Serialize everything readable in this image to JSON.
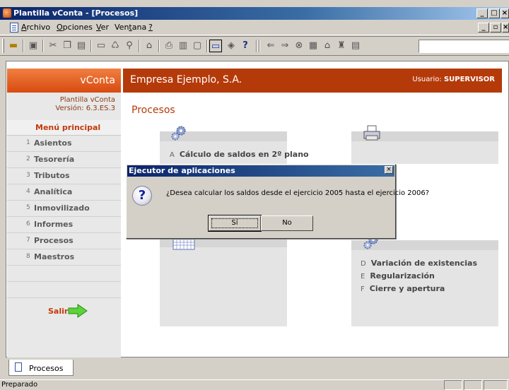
{
  "window": {
    "title": "Plantilla vConta - [Procesos]"
  },
  "menu": {
    "items": [
      {
        "accel": "A",
        "rest": "rchivo"
      },
      {
        "accel": "O",
        "rest": "pciones"
      },
      {
        "accel": "V",
        "rest": "er"
      },
      {
        "pre": "Ven",
        "accel": "t",
        "rest": "ana"
      },
      {
        "accel": "?",
        "rest": ""
      }
    ]
  },
  "sidebar": {
    "brand": "vConta",
    "template_name": "Plantilla vConta",
    "version": "Versión: 6.3.ES.3",
    "section_title": "Menú principal",
    "items": [
      {
        "num": "1",
        "label": "Asientos"
      },
      {
        "num": "2",
        "label": "Tesorería"
      },
      {
        "num": "3",
        "label": "Tributos"
      },
      {
        "num": "4",
        "label": "Analítica"
      },
      {
        "num": "5",
        "label": "Inmovilizado"
      },
      {
        "num": "6",
        "label": "Informes"
      },
      {
        "num": "7",
        "label": "Procesos"
      },
      {
        "num": "8",
        "label": "Maestros"
      }
    ],
    "exit_label": "Salir"
  },
  "header": {
    "company": "Empresa Ejemplo, S.A.",
    "user_prefix": "Usuario: ",
    "user_name": "SUPERVISOR"
  },
  "page": {
    "title": "Procesos"
  },
  "cards": {
    "saldos": {
      "letter": "A",
      "label": "Cálculo de saldos en 2º plano"
    },
    "cierre": [
      {
        "letter": "D",
        "label": "Variación de existencias"
      },
      {
        "letter": "E",
        "label": "Regularización"
      },
      {
        "letter": "F",
        "label": "Cierre y apertura"
      }
    ]
  },
  "dialog": {
    "title": "Ejecutor de aplicaciones",
    "message": "¿Desea calcular los saldos desde el ejercicio 2005 hasta el ejercicio 2006?",
    "yes_label": "Sí",
    "no_label": "No",
    "close_glyph": "×"
  },
  "tabs": {
    "active_label": "Procesos"
  },
  "status": {
    "text": "Preparado"
  },
  "colors": {
    "brand_orange": "#d84a10",
    "header_red": "#b53a0a",
    "menu_accent": "#c23a0a"
  }
}
